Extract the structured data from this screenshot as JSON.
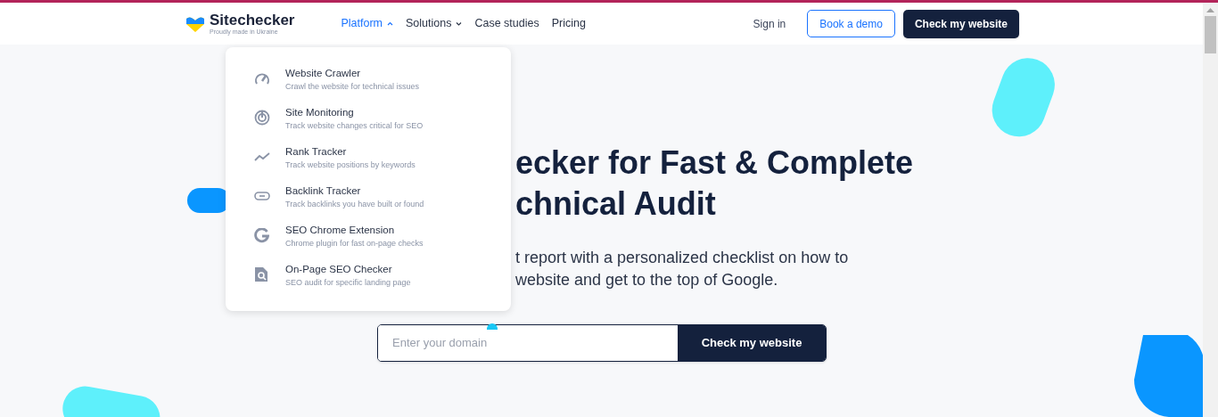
{
  "header": {
    "logo": {
      "name": "Sitechecker",
      "tagline": "Proudly made in Ukraine"
    },
    "nav": [
      {
        "label": "Platform",
        "expanded": true,
        "selected": true
      },
      {
        "label": "Solutions",
        "expanded": false,
        "selected": false
      },
      {
        "label": "Case studies",
        "selected": false
      },
      {
        "label": "Pricing",
        "selected": false
      }
    ],
    "sign_in": "Sign in",
    "book_demo": "Book a demo",
    "cta": "Check my website"
  },
  "platform_menu": [
    {
      "kind": "gauge",
      "title": "Website Crawler",
      "description": "Crawl the website for technical issues"
    },
    {
      "kind": "radar",
      "title": "Site Monitoring",
      "description": "Track website changes critical for SEO"
    },
    {
      "kind": "trend",
      "title": "Rank Tracker",
      "description": "Track website positions by keywords"
    },
    {
      "kind": "link",
      "title": "Backlink Tracker",
      "description": "Track backlinks you have built or found"
    },
    {
      "kind": "google",
      "title": "SEO Chrome Extension",
      "description": "Chrome plugin for fast on-page checks"
    },
    {
      "kind": "audit",
      "title": "On-Page SEO Checker",
      "description": "SEO audit for specific landing page"
    }
  ],
  "hero": {
    "heading_lines": [
      "ecker for Fast & Complete",
      "chnical Audit"
    ],
    "subtitle_lines": [
      "t report with a personalized checklist on how to",
      "website and get to the top of Google."
    ],
    "domain_field": {
      "placeholder": "Enter your domain"
    },
    "submit": "Check my website"
  }
}
